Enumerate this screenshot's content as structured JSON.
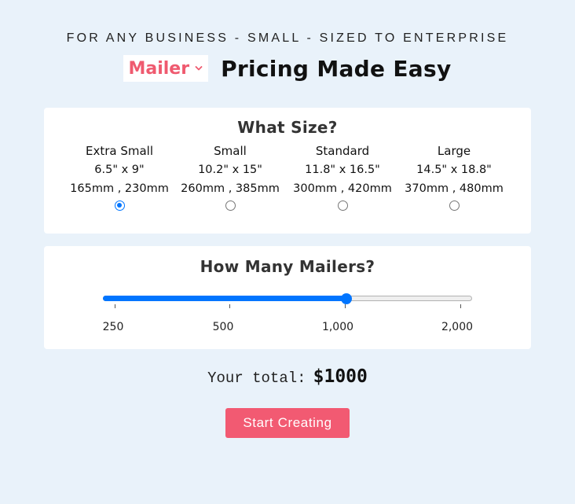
{
  "header": {
    "tagline": "FOR ANY BUSINESS - SMALL - SIZED TO ENTERPRISE",
    "product_select": {
      "value": "Mailer",
      "icon": "chevron-down-icon"
    },
    "title": "Pricing Made Easy"
  },
  "colors": {
    "background": "#e9f2fa",
    "brand": "#ef5a6f",
    "button": "#f25a72",
    "accent": "#0075ff"
  },
  "size_card": {
    "title": "What Size?",
    "options": [
      {
        "name": "Extra Small",
        "inches": "6.5\" x 9\"",
        "mm": "165mm , 230mm",
        "selected": true
      },
      {
        "name": "Small",
        "inches": "10.2\" x 15\"",
        "mm": "260mm , 385mm",
        "selected": false
      },
      {
        "name": "Standard",
        "inches": "11.8\" x 16.5\"",
        "mm": "300mm , 420mm",
        "selected": false
      },
      {
        "name": "Large",
        "inches": "14.5\" x 18.8\"",
        "mm": "370mm , 480mm",
        "selected": false
      }
    ]
  },
  "quantity_card": {
    "title": "How Many Mailers?",
    "ticks": [
      "250",
      "500",
      "1,000",
      "2,000"
    ],
    "selected_index": 2,
    "slider_fraction": 0.66
  },
  "total": {
    "label": "Your total:",
    "amount": "$1000"
  },
  "cta": {
    "label": "Start Creating"
  }
}
